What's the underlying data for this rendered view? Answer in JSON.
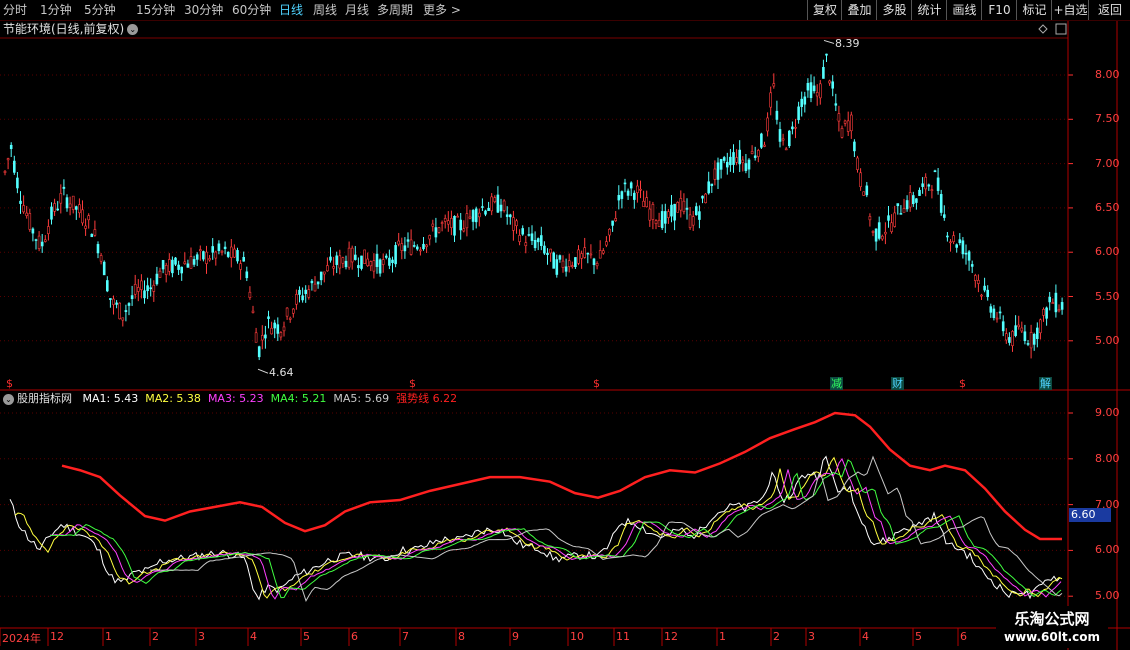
{
  "toolbar": {
    "periods": [
      {
        "label": "分时",
        "name": "period-timeshare"
      },
      {
        "label": "1分钟",
        "name": "period-1min"
      },
      {
        "label": "5分钟",
        "name": "period-5min"
      },
      {
        "label": "15分钟",
        "name": "period-15min"
      },
      {
        "label": "30分钟",
        "name": "period-30min"
      },
      {
        "label": "60分钟",
        "name": "period-60min"
      },
      {
        "label": "日线",
        "name": "period-daily",
        "active": true
      },
      {
        "label": "周线",
        "name": "period-weekly"
      },
      {
        "label": "月线",
        "name": "period-monthly"
      },
      {
        "label": "多周期",
        "name": "period-multi"
      },
      {
        "label": "更多 >",
        "name": "period-more"
      }
    ],
    "buttons": [
      {
        "label": "复权",
        "name": "rights-button"
      },
      {
        "label": "叠加",
        "name": "overlay-button"
      },
      {
        "label": "多股",
        "name": "multi-stock-button"
      },
      {
        "label": "统计",
        "name": "stats-button"
      },
      {
        "label": "画线",
        "name": "draw-line-button"
      },
      {
        "label": "F10",
        "name": "f10-button"
      },
      {
        "label": "标记",
        "name": "mark-button"
      },
      {
        "label": "+自选",
        "name": "add-watchlist-button"
      },
      {
        "label": "返回",
        "name": "back-button"
      }
    ]
  },
  "main_chart": {
    "title": "节能环境(日线,前复权)",
    "high_label": "8.39",
    "low_label": "4.64",
    "y_ticks": [
      "8.00",
      "7.50",
      "7.00",
      "6.50",
      "6.00",
      "5.50",
      "5.00"
    ],
    "markers": [
      {
        "text": "$",
        "color": "#ff3030"
      },
      {
        "text": "$",
        "color": "#ff3030"
      },
      {
        "text": "$",
        "color": "#ff3030"
      },
      {
        "text": "减",
        "color": "#30ff60"
      },
      {
        "text": "财",
        "color": "#4fd3ff"
      },
      {
        "text": "$",
        "color": "#ff3030"
      },
      {
        "text": "解",
        "color": "#4fd3ff"
      }
    ]
  },
  "indicator": {
    "name": "股朋指标网",
    "items": [
      {
        "label": "MA1: 5.43",
        "color": "#ffffff"
      },
      {
        "label": "MA2: 5.38",
        "color": "#ffff40"
      },
      {
        "label": "MA3: 5.23",
        "color": "#ff40ff"
      },
      {
        "label": "MA4: 5.21",
        "color": "#40ff40"
      },
      {
        "label": "MA5: 5.69",
        "color": "#c8c8c8"
      },
      {
        "label": "强势线  6.22",
        "color": "#ff2020"
      }
    ],
    "y_ticks": [
      "9.00",
      "8.00",
      "7.00",
      "6.00",
      "5.00"
    ],
    "current_value": "6.60"
  },
  "x_axis": {
    "labels": [
      "2024年",
      "12",
      "1",
      "2",
      "3",
      "4",
      "5",
      "6",
      "7",
      "8",
      "9",
      "10",
      "11",
      "12",
      "1",
      "2",
      "3",
      "4",
      "5",
      "6"
    ]
  },
  "watermark": {
    "title": "乐淘公式网",
    "url": "www.60lt.com"
  },
  "colors": {
    "up": "#ff3c3c",
    "down": "#54ffff",
    "grid": "#5a0000",
    "strength": "#ff2020"
  }
}
